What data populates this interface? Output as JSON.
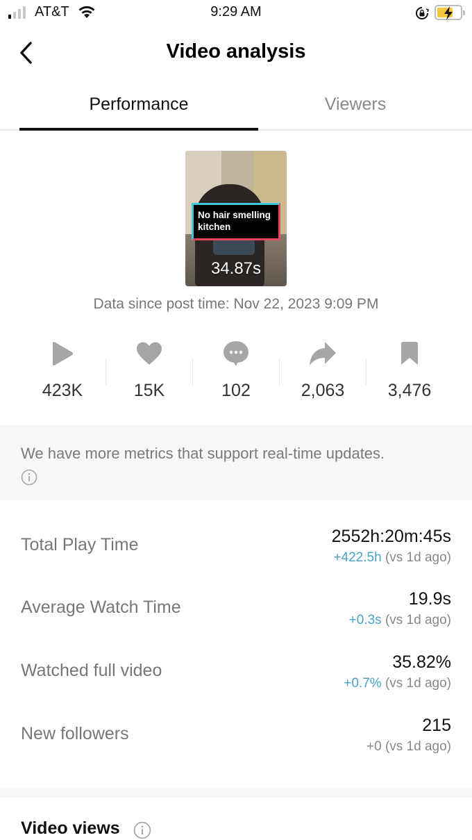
{
  "status_bar": {
    "carrier": "AT&T",
    "time": "9:29 AM",
    "signal_bars_on": 1,
    "signal_bars_total": 4,
    "battery_charging": true,
    "battery_color": "#f4c63c"
  },
  "header": {
    "title": "Video analysis",
    "back_icon": "chevron-left-icon"
  },
  "tabs": [
    {
      "label": "Performance",
      "active": true
    },
    {
      "label": "Viewers",
      "active": false
    }
  ],
  "video": {
    "caption": "No hair smelling kitchen",
    "duration": "34.87s"
  },
  "post_time": "Data since post time: Nov 22, 2023 9:09 PM",
  "stats": [
    {
      "icon": "play-icon",
      "value": "423K"
    },
    {
      "icon": "heart-icon",
      "value": "15K"
    },
    {
      "icon": "comment-icon",
      "value": "102"
    },
    {
      "icon": "share-icon",
      "value": "2,063"
    },
    {
      "icon": "bookmark-icon",
      "value": "3,476"
    }
  ],
  "notice": {
    "text": "We have more metrics that support real-time updates.",
    "icon": "info-icon"
  },
  "metrics": [
    {
      "label": "Total Play Time",
      "value": "2552h:20m:45s",
      "delta": "+422.5h",
      "delta_suffix": "(vs 1d ago)",
      "delta_positive": true
    },
    {
      "label": "Average Watch Time",
      "value": "19.9s",
      "delta": "+0.3s",
      "delta_suffix": "(vs 1d ago)",
      "delta_positive": true
    },
    {
      "label": "Watched full video",
      "value": "35.82%",
      "delta": "+0.7%",
      "delta_suffix": "(vs 1d ago)",
      "delta_positive": true
    },
    {
      "label": "New followers",
      "value": "215",
      "delta": "+0",
      "delta_suffix": "(vs 1d ago)",
      "delta_positive": false
    }
  ],
  "video_views": {
    "title": "Video views",
    "icon": "info-icon"
  },
  "colors": {
    "positive_delta": "#4aa3c7",
    "icon_gray": "#a6a6a6",
    "caption_border_cyan": "#3fc6d8",
    "caption_border_red": "#e94560"
  }
}
